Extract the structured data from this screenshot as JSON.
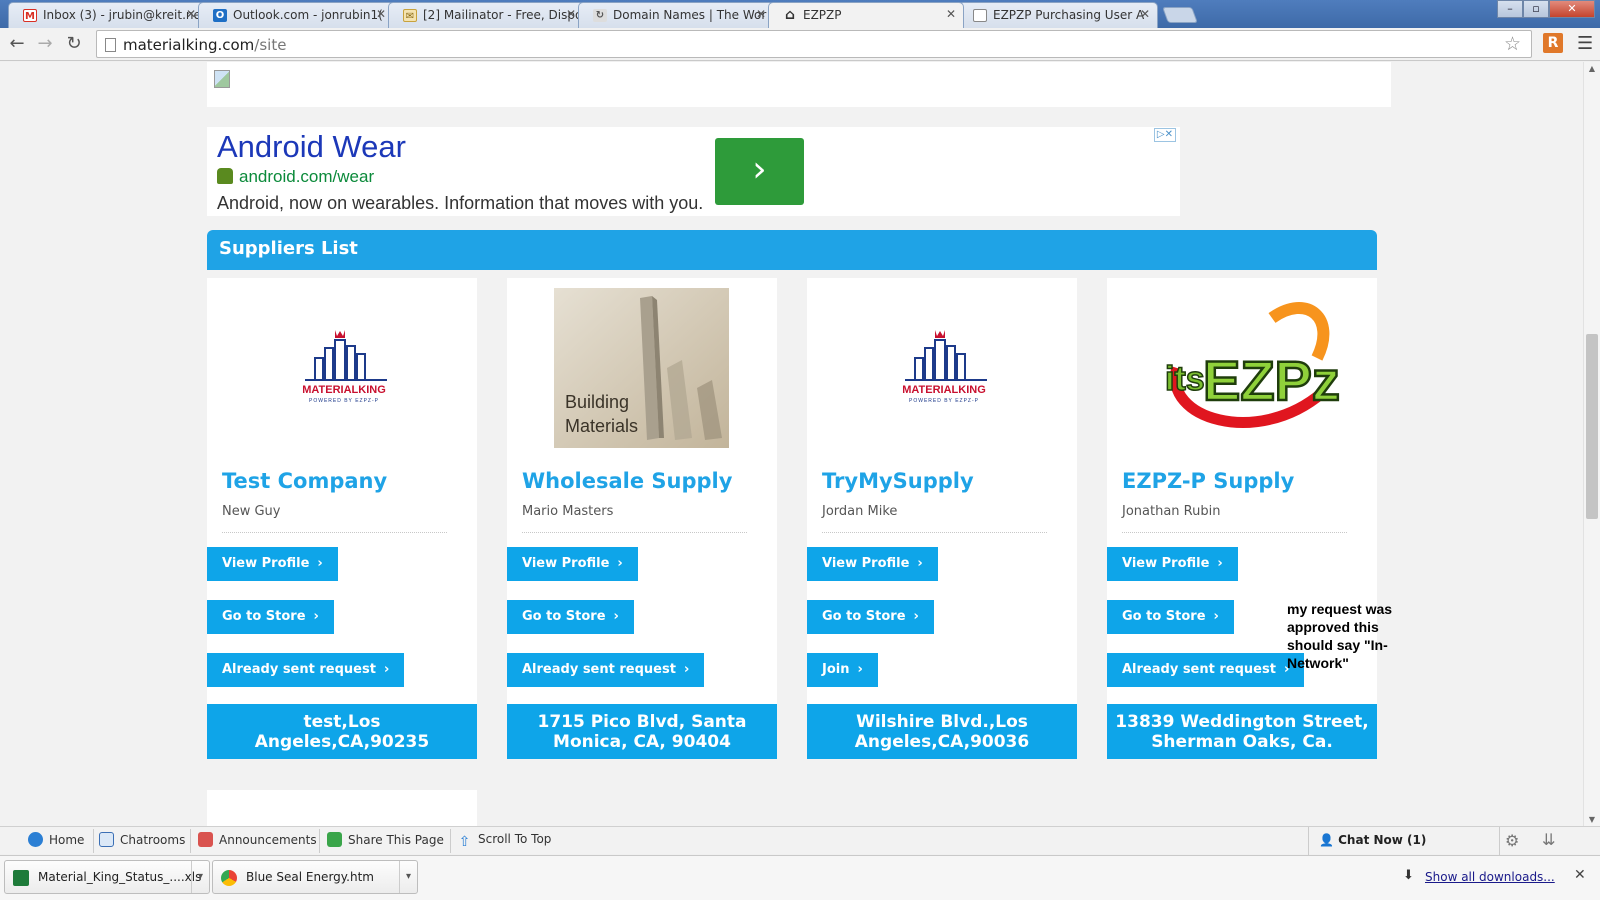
{
  "browser": {
    "tabs": [
      {
        "title": "Inbox (3) - jrubin@kreit.ne",
        "icon": "gmail-icon",
        "color": "#d93025"
      },
      {
        "title": "Outlook.com - jonrubin1(",
        "icon": "outlook-icon",
        "color": "#1f6fc5"
      },
      {
        "title": "[2] Mailinator - Free, Dispo",
        "icon": "mailinator-icon",
        "color": "#c8a23c"
      },
      {
        "title": "Domain Names | The Wor",
        "icon": "domain-icon",
        "color": "#777777"
      },
      {
        "title": "EZPZP",
        "icon": "home-icon",
        "color": "#333333"
      },
      {
        "title": "EZPZP Purchasing User A",
        "icon": "page-icon",
        "color": "#777777"
      }
    ],
    "url_host": "materialking.com",
    "url_path": "/site",
    "window_buttons": {
      "minimize": "–",
      "maximize": "▫",
      "close": "✕"
    }
  },
  "ad": {
    "title": "Android Wear",
    "url": "android.com/wear",
    "description": "Android, now on wearables. Information that moves with you.",
    "choices": "▷✕"
  },
  "suppliers": {
    "header": "Suppliers List",
    "cards": [
      {
        "logo": "materialking-logo",
        "company": "Test Company",
        "contact": "New Guy",
        "view_profile": "View Profile",
        "go_to_store": "Go to Store",
        "action": "Already sent request",
        "address": "test,Los Angeles,CA,90235"
      },
      {
        "logo": "building-materials-image",
        "logo_text": "Building Materials",
        "company": "Wholesale Supply",
        "contact": "Mario Masters",
        "view_profile": "View Profile",
        "go_to_store": "Go to Store",
        "action": "Already sent request",
        "address": "1715 Pico Blvd, Santa Monica, CA, 90404"
      },
      {
        "logo": "materialking-logo",
        "company": "TryMySupply",
        "contact": "Jordan Mike",
        "view_profile": "View Profile",
        "go_to_store": "Go to Store",
        "action": "Join",
        "address": "Wilshire Blvd.,Los Angeles,CA,90036"
      },
      {
        "logo": "itsezpz-logo",
        "company": "EZPZ-P Supply",
        "contact": "Jonathan Rubin",
        "view_profile": "View Profile",
        "go_to_store": "Go to Store",
        "action": "Already sent request",
        "address": "13839 Weddington Street, Sherman Oaks, Ca."
      }
    ],
    "logo_text": {
      "materialking": "MATERIALKING",
      "materialking_tagline": "POWERED BY EZPZ-P",
      "itsezpz_its": "its",
      "itsezpz_brand": "EZPz"
    }
  },
  "annotation": "my request was approved this should say \"In-Network\"",
  "site_bar": {
    "items": [
      "Home",
      "Chatrooms",
      "Announcements",
      "Share This Page",
      "Scroll To Top"
    ],
    "chat_now": "Chat Now (1)"
  },
  "downloads": {
    "items": [
      "Material_King_Status_....xls",
      "Blue Seal Energy.htm"
    ],
    "show_all": "Show all downloads..."
  },
  "colors": {
    "accent": "#0ea5e9",
    "header": "#1fa3e6",
    "ad_button": "#2e9b3a"
  }
}
